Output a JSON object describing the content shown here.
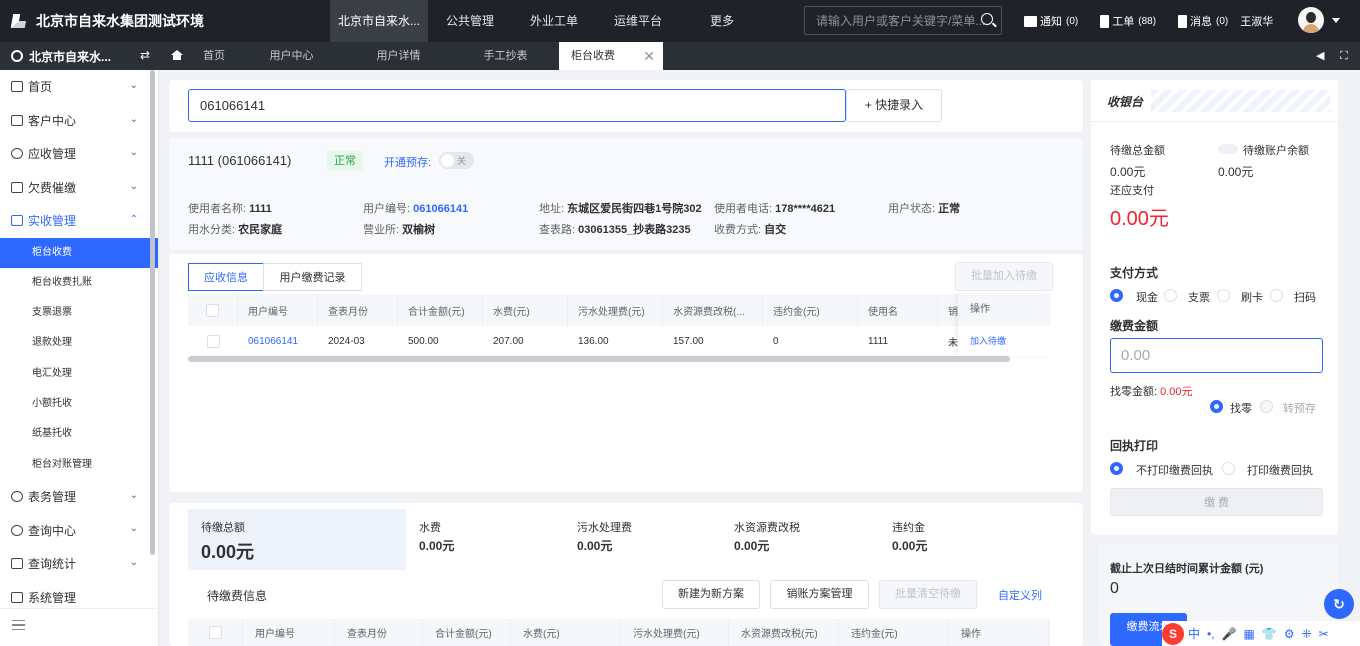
{
  "app": {
    "title": "北京市自来水集团测试环境"
  },
  "topnav": [
    "北京市自来水...",
    "公共管理",
    "外业工单",
    "运维平台",
    "更多"
  ],
  "search": {
    "placeholder": "请输入用户或客户关键字/菜单..."
  },
  "top_right": {
    "notice": {
      "label": "通知",
      "count": "(0)"
    },
    "workorder": {
      "label": "工单",
      "count": "(88)"
    },
    "message": {
      "label": "消息",
      "count": "(0)"
    },
    "user": "王淑华"
  },
  "org": "北京市自来水...",
  "tabs": [
    "首页",
    "用户中心",
    "用户详情",
    "手工抄表",
    "柜台收费"
  ],
  "sidebar": {
    "groups_top": [
      "首页",
      "客户中心",
      "应收管理",
      "欠费催缴",
      "实收管理"
    ],
    "subitems": [
      "柜台收费",
      "柜台收费扎账",
      "支票退票",
      "退款处理",
      "电汇处理",
      "小额托收",
      "纸基托收",
      "柜台对账管理"
    ],
    "groups_bottom": [
      "表务管理",
      "查询中心",
      "查询统计",
      "系统管理"
    ]
  },
  "entry": {
    "value": "061066141",
    "quick_label": "+ 快捷录入"
  },
  "customer": {
    "title": "1111 (061066141)",
    "status": "正常",
    "prepay_label": "开通预存:",
    "prepay_toggle": "关",
    "row1": [
      {
        "label": "使用者名称:",
        "value": "1111"
      },
      {
        "label": "用户编号:",
        "value": "061066141"
      },
      {
        "label": "地址:",
        "value": "东城区爱民街四巷1号院302"
      },
      {
        "label": "使用者电话:",
        "value": "178****4621"
      },
      {
        "label": "用户状态:",
        "value": "正常"
      }
    ],
    "row2": [
      {
        "label": "用水分类:",
        "value": "农民家庭"
      },
      {
        "label": "营业所:",
        "value": "双榆树"
      },
      {
        "label": "查表路:",
        "value": "03061355_抄表路3235"
      },
      {
        "label": "收费方式:",
        "value": "自交"
      }
    ]
  },
  "records": {
    "tabs": [
      "应收信息",
      "用户缴费记录"
    ],
    "batch_add": "批量加入待缴",
    "columns": [
      "用户编号",
      "查表月份",
      "合计金额(元)",
      "水费(元)",
      "污水处理费(元)",
      "水资源费改税(...",
      "违约金(元)",
      "使用名",
      "销"
    ],
    "rows": [
      [
        "061066141",
        "2024-03",
        "500.00",
        "207.00",
        "136.00",
        "157.00",
        "0",
        "1111",
        "未"
      ]
    ],
    "op_header": "操作",
    "op_action": "加入待缴"
  },
  "pending_summary": {
    "total_label": "待缴总额",
    "total_value": "0.00元",
    "items": [
      {
        "label": "水费",
        "value": "0.00元"
      },
      {
        "label": "污水处理费",
        "value": "0.00元"
      },
      {
        "label": "水资源费改税",
        "value": "0.00元"
      },
      {
        "label": "违约金",
        "value": "0.00元"
      }
    ]
  },
  "pending_info": {
    "title": "待缴费信息",
    "new_plan": "新建为新方案",
    "manage_plan": "销账方案管理",
    "batch_clear": "批量清空待缴",
    "custom_cols": "自定义列",
    "columns": [
      "用户编号",
      "查表月份",
      "合计金额(元)",
      "水费(元)",
      "污水处理费(元)",
      "水资源费改税(元)",
      "违约金(元)",
      "操作"
    ]
  },
  "cashier": {
    "title": "收银台",
    "total_due_label": "待缴总金额",
    "total_due": "0.00元",
    "balance_label": "待缴账户余额",
    "balance": "0.00元",
    "payable_label": "还应支付",
    "payable": "0.00元",
    "pay_method_label": "支付方式",
    "pay_methods": [
      "现金",
      "支票",
      "刷卡",
      "扫码"
    ],
    "fee_label": "缴费金额",
    "fee_placeholder": "0.00",
    "change_label": "找零金额:",
    "change_value": "0.00元",
    "change_opts": [
      "找零",
      "转预存"
    ],
    "receipt_label": "回执打印",
    "receipt_opts": [
      "不打印缴费回执",
      "打印缴费回执"
    ],
    "pay_button": "缴 费",
    "cumulative_label": "截止上次日结时间累计金额 (元)",
    "cumulative_value": "0",
    "flow_button": "缴费流水"
  },
  "ime": [
    "中",
    "•,",
    "🎤",
    "▦",
    "👕",
    "⚙",
    "⁜",
    "✂"
  ]
}
